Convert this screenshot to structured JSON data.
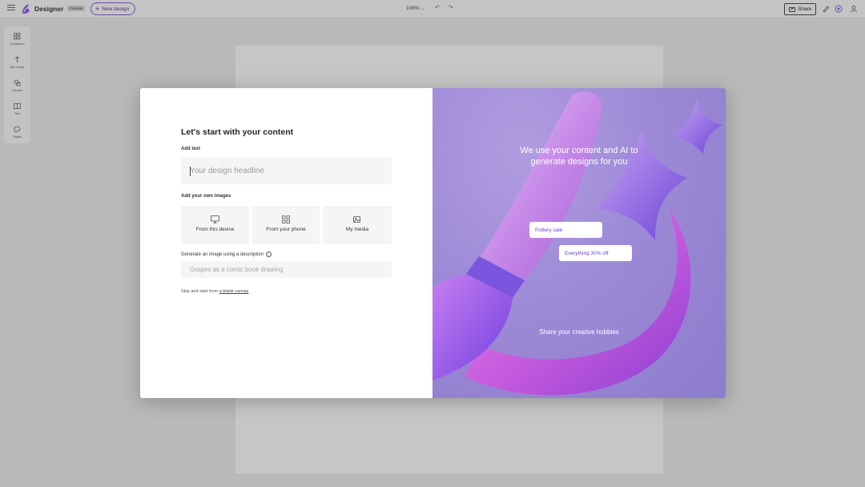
{
  "topbar": {
    "brand": "Designer",
    "badge": "Preview",
    "new_design": "New design",
    "zoom": "106%",
    "share": "Share"
  },
  "rail": {
    "items": [
      {
        "label": "Templates",
        "icon": "templates-icon"
      },
      {
        "label": "My media",
        "icon": "media-icon"
      },
      {
        "label": "Visuals",
        "icon": "visuals-icon"
      },
      {
        "label": "Text",
        "icon": "text-icon"
      },
      {
        "label": "Styles",
        "icon": "styles-icon"
      }
    ]
  },
  "dialog": {
    "title": "Let's start with your content",
    "add_text_label": "Add text",
    "headline_placeholder": "Your design headline",
    "images_label": "Add your own images",
    "tiles": [
      {
        "label": "From this device",
        "icon": "monitor-icon"
      },
      {
        "label": "From your phone",
        "icon": "qr-code-icon"
      },
      {
        "label": "My media",
        "icon": "media-library-icon"
      }
    ],
    "generate_label": "Generate an image using a description",
    "description_placeholder": "Grapes as a comic book drawing",
    "skip_text": "Skip and start from",
    "skip_link": "a blank canvas"
  },
  "promo": {
    "title_line1": "We use your content and AI to",
    "title_line2": "generate designs for you",
    "chip1": "Pottery sale",
    "chip2": "Everything 30% off",
    "caption": "Share your creative hobbies"
  },
  "colors": {
    "accent": "#6b3fd6",
    "promo_bg": "#9d8ad6",
    "overlay": "#b9b9b9"
  }
}
